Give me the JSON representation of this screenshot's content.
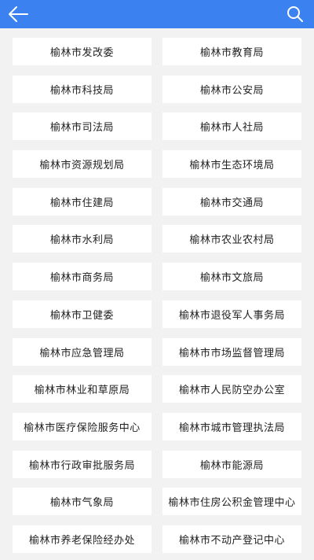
{
  "header": {
    "back_icon": "arrow-left-icon",
    "search_icon": "search-icon",
    "accent_color": "#3b82f0"
  },
  "departments": [
    [
      "榆林市发改委",
      "榆林市教育局"
    ],
    [
      "榆林市科技局",
      "榆林市公安局"
    ],
    [
      "榆林市司法局",
      "榆林市人社局"
    ],
    [
      "榆林市资源规划局",
      "榆林市生态环境局"
    ],
    [
      "榆林市住建局",
      "榆林市交通局"
    ],
    [
      "榆林市水利局",
      "榆林市农业农村局"
    ],
    [
      "榆林市商务局",
      "榆林市文旅局"
    ],
    [
      "榆林市卫健委",
      "榆林市退役军人事务局"
    ],
    [
      "榆林市应急管理局",
      "榆林市市场监督管理局"
    ],
    [
      "榆林市林业和草原局",
      "榆林市人民防空办公室"
    ],
    [
      "榆林市医疗保险服务中心",
      "榆林市城市管理执法局"
    ],
    [
      "榆林市行政审批服务局",
      "榆林市能源局"
    ],
    [
      "榆林市气象局",
      "榆林市住房公积金管理中心"
    ],
    [
      "榆林市养老保险经办处",
      "榆林市不动产登记中心"
    ]
  ]
}
